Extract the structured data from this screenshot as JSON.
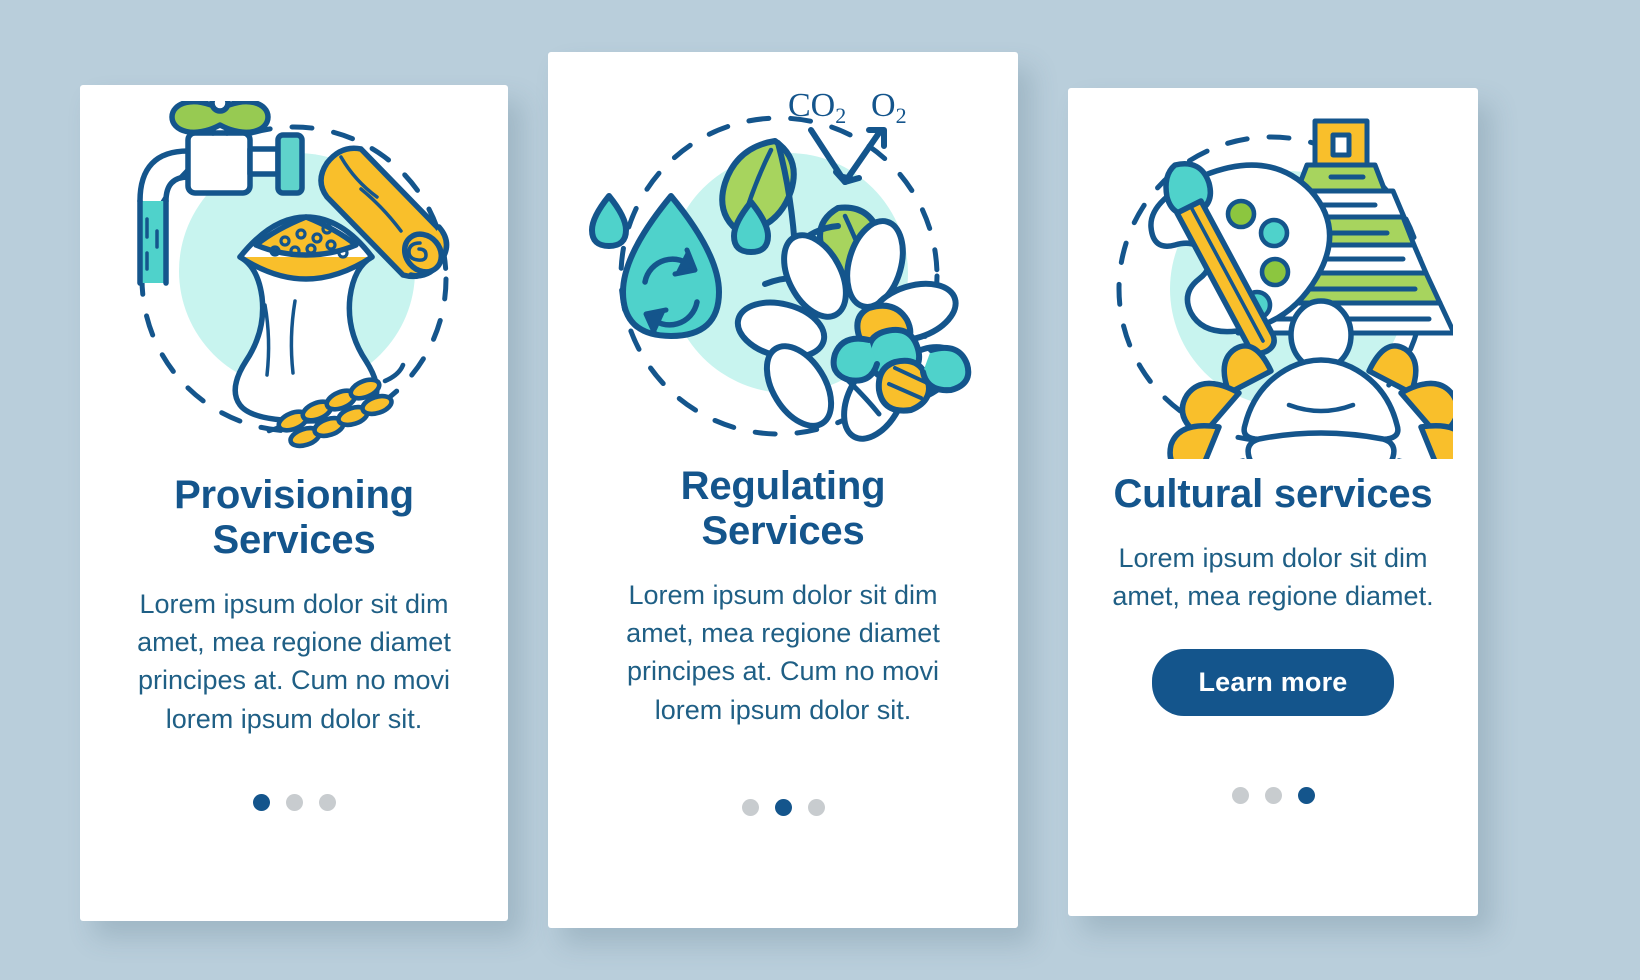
{
  "page": {
    "background_color": "#b9cedb",
    "card_background": "#ffffff"
  },
  "theme": {
    "title_color": "#14558c",
    "body_color": "#1f5f85",
    "outline_color": "#14558c",
    "accent_teal": "#3fd0c9",
    "accent_mint": "#c8f4ef",
    "accent_green": "#8cc63f",
    "accent_yellow": "#f9bf2b",
    "dot_inactive": "#c8cccf",
    "dot_active": "#14558c",
    "button_color": "#14558c",
    "button_text_color": "#ffffff"
  },
  "cards": [
    {
      "id": "provisioning",
      "title": "Provisioning Services",
      "description": "Lorem ipsum dolor sit dim amet, mea regione diamet principes at. Cum no movi lorem ipsum dolor sit.",
      "illustration_name": "provisioning-services-illustration",
      "illustration_elements": [
        "faucet-icon",
        "log-icon",
        "grain-sack-icon",
        "wheat-icon",
        "dashed-circle"
      ],
      "has_button": false,
      "pagination": {
        "total": 3,
        "active_index": 0
      }
    },
    {
      "id": "regulating",
      "title": "Regulating Services",
      "description": "Lorem ipsum dolor sit dim amet, mea regione diamet principes at. Cum no movi lorem ipsum dolor sit.",
      "illustration_name": "regulating-services-illustration",
      "illustration_elements": [
        "water-drop-recycle-icon",
        "sprout-icon",
        "co2-o2-arrow",
        "flower-icon",
        "bee-icon",
        "dashed-circle"
      ],
      "labels": {
        "co2": "CO",
        "co2_sub": "2",
        "o2": "O",
        "o2_sub": "2"
      },
      "has_button": false,
      "pagination": {
        "total": 3,
        "active_index": 1
      }
    },
    {
      "id": "cultural",
      "title": "Cultural services",
      "description": "Lorem ipsum dolor sit dim amet, mea regione diamet.",
      "illustration_name": "cultural-services-illustration",
      "illustration_elements": [
        "paint-palette-icon",
        "paintbrush-icon",
        "pyramid-icon",
        "meditating-person-lotus-icon",
        "dashed-circle"
      ],
      "button_label": "Learn more",
      "has_button": true,
      "pagination": {
        "total": 3,
        "active_index": 2
      }
    }
  ]
}
